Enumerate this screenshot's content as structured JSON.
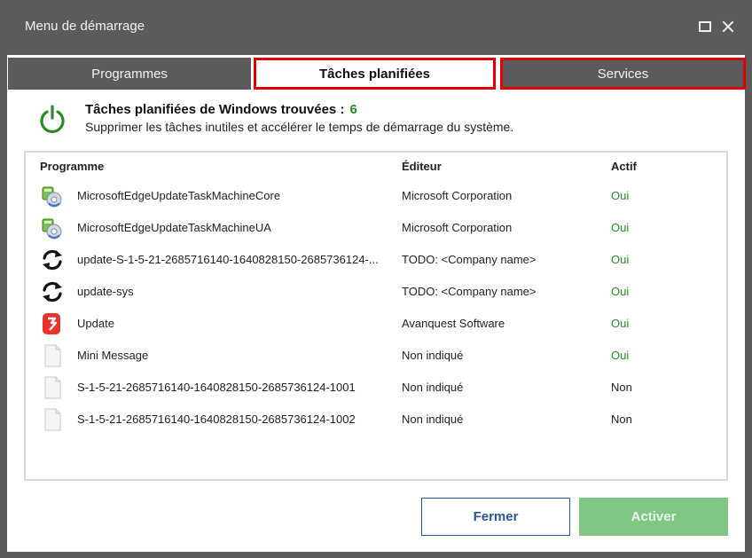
{
  "window": {
    "title": "Menu de démarrage"
  },
  "tabs": [
    {
      "label": "Programmes"
    },
    {
      "label": "Tâches planifiées"
    },
    {
      "label": "Services"
    }
  ],
  "header": {
    "title": "Tâches planifiées de Windows trouvées :",
    "count": "6",
    "subtitle": "Supprimer les tâches inutiles et accélérer le temps de démarrage du système."
  },
  "table": {
    "columns": {
      "program": "Programme",
      "editor": "Éditeur",
      "active": "Actif"
    },
    "rows": [
      {
        "icon": "edge-update-icon",
        "name": "MicrosoftEdgeUpdateTaskMachineCore",
        "editor": "Microsoft Corporation",
        "active": "Oui"
      },
      {
        "icon": "edge-update-icon",
        "name": "MicrosoftEdgeUpdateTaskMachineUA",
        "editor": "Microsoft Corporation",
        "active": "Oui"
      },
      {
        "icon": "sync-icon",
        "name": "update-S-1-5-21-2685716140-1640828150-2685736124-...",
        "editor": "TODO: <Company name>",
        "active": "Oui"
      },
      {
        "icon": "sync-icon",
        "name": "update-sys",
        "editor": "TODO: <Company name>",
        "active": "Oui"
      },
      {
        "icon": "avanquest-icon",
        "name": "Update",
        "editor": "Avanquest Software",
        "active": "Oui"
      },
      {
        "icon": "blank-file-icon",
        "name": "Mini Message",
        "editor": "Non indiqué",
        "active": "Oui"
      },
      {
        "icon": "blank-file-icon",
        "name": "S-1-5-21-2685716140-1640828150-2685736124-1001",
        "editor": "Non indiqué",
        "active": "Non"
      },
      {
        "icon": "blank-file-icon",
        "name": "S-1-5-21-2685716140-1640828150-2685736124-1002",
        "editor": "Non indiqué",
        "active": "Non"
      }
    ]
  },
  "buttons": {
    "close": "Fermer",
    "activate": "Activer"
  },
  "colors": {
    "titlebar": "#5b5b5b",
    "highlight": "#e00000",
    "active_green": "#2a8a2a",
    "primary_blue": "#2b5797",
    "activate_disabled": "#80c784"
  }
}
